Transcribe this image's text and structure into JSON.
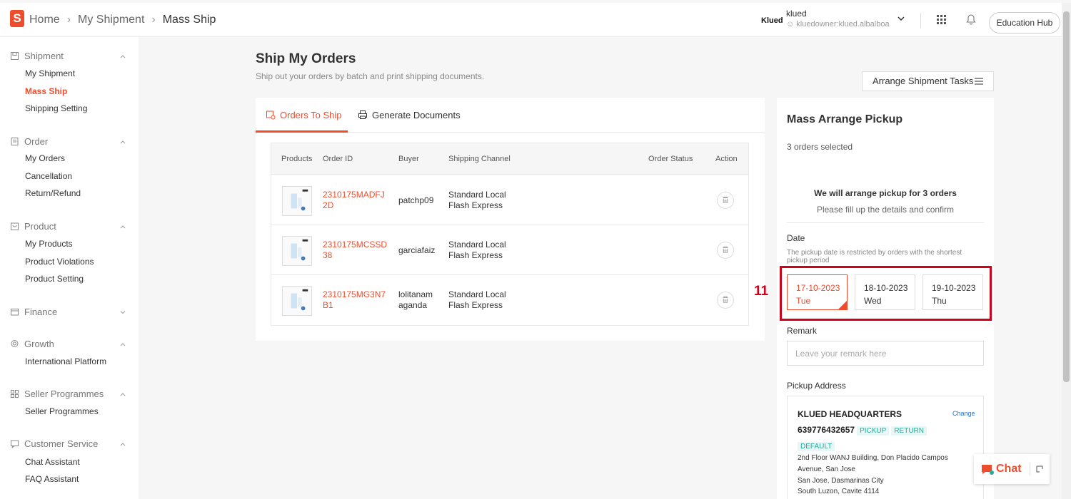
{
  "header": {
    "logo_letter": "S",
    "breadcrumb": [
      "Home",
      "My Shipment",
      "Mass Ship"
    ],
    "account_logo": "Klued",
    "account_name": "klued",
    "account_sub": "kluedowner:klued.albalboa",
    "education_hub": "Education Hub"
  },
  "sidebar": {
    "sections": [
      {
        "label": "Shipment",
        "icon": "shipment-icon",
        "items": [
          "My Shipment",
          "Mass Ship",
          "Shipping Setting"
        ],
        "active": "Mass Ship"
      },
      {
        "label": "Order",
        "icon": "order-icon",
        "items": [
          "My Orders",
          "Cancellation",
          "Return/Refund"
        ]
      },
      {
        "label": "Product",
        "icon": "product-icon",
        "items": [
          "My Products",
          "Product Violations",
          "Product Setting"
        ]
      },
      {
        "label": "Finance",
        "icon": "finance-icon",
        "items": []
      },
      {
        "label": "Growth",
        "icon": "growth-icon",
        "items": [
          "International Platform"
        ]
      },
      {
        "label": "Seller Programmes",
        "icon": "seller-programmes-icon",
        "items": [
          "Seller Programmes"
        ]
      },
      {
        "label": "Customer Service",
        "icon": "customer-service-icon",
        "items": [
          "Chat Assistant",
          "FAQ Assistant"
        ]
      }
    ]
  },
  "main": {
    "title": "Ship My Orders",
    "subtitle": "Ship out your orders by batch and print shipping documents.",
    "arrange_button": "Arrange Shipment Tasks",
    "tabs": [
      "Orders To Ship",
      "Generate Documents"
    ],
    "columns": [
      "Products",
      "Order ID",
      "Buyer",
      "Shipping Channel",
      "Order Status",
      "Action"
    ],
    "orders": [
      {
        "order_id_l1": "2310175MADFJ",
        "order_id_l2": "2D",
        "buyer_l1": "patchp09",
        "buyer_l2": "",
        "channel_l1": "Standard Local",
        "channel_l2": "Flash Express"
      },
      {
        "order_id_l1": "2310175MCSSD",
        "order_id_l2": "38",
        "buyer_l1": "garciafaiz",
        "buyer_l2": "",
        "channel_l1": "Standard Local",
        "channel_l2": "Flash Express"
      },
      {
        "order_id_l1": "2310175MG3N7",
        "order_id_l2": "B1",
        "buyer_l1": "lolitanam",
        "buyer_l2": "aganda",
        "channel_l1": "Standard Local",
        "channel_l2": "Flash Express"
      }
    ]
  },
  "panel": {
    "title": "Mass Arrange Pickup",
    "selected": "3 orders selected",
    "notice_title": "We will arrange pickup for 3 orders",
    "notice_sub": "Please fill up the details and confirm",
    "date_label": "Date",
    "date_hint": "The pickup date is restricted by orders with the shortest pickup period",
    "dates": [
      {
        "date": "17-10-2023",
        "day": "Tue",
        "selected": true
      },
      {
        "date": "18-10-2023",
        "day": "Wed",
        "selected": false
      },
      {
        "date": "19-10-2023",
        "day": "Thu",
        "selected": false
      }
    ],
    "annotation": "11",
    "remark_label": "Remark",
    "remark_placeholder": "Leave your remark here",
    "address_label": "Pickup Address",
    "address": {
      "name": "KLUED HEADQUARTERS",
      "change": "Change",
      "phone": "639776432657",
      "tags": [
        "PICKUP",
        "RETURN"
      ],
      "default_tag": "DEFAULT",
      "lines": [
        "2nd Floor WANJ Building, Don Placido Campos",
        "Avenue, San Jose",
        "San Jose, Dasmarinas City",
        "South Luzon, Cavite 4114"
      ]
    }
  },
  "chat": {
    "label": "Chat"
  },
  "colors": {
    "accent": "#ee4d2d",
    "highlight": "#d0021b",
    "tag": "#26aa99",
    "link": "#2673dd"
  }
}
